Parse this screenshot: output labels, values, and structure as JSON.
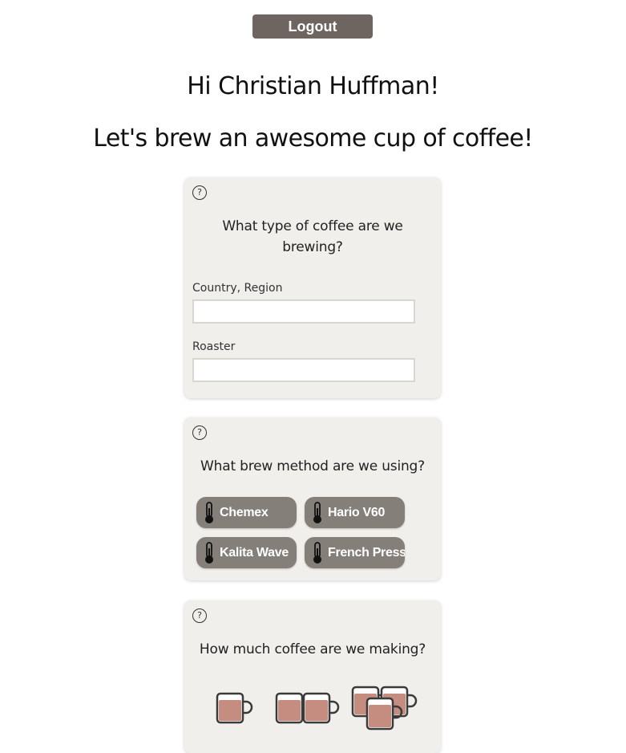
{
  "header": {
    "logout_label": "Logout"
  },
  "greeting": {
    "hello": "Hi Christian Huffman!",
    "tagline": "Let's brew an awesome cup of coffee!"
  },
  "coffee_type": {
    "help": "?",
    "question": "What type of coffee are we brewing?",
    "fields": [
      {
        "label": "Country, Region",
        "value": "",
        "placeholder": ""
      },
      {
        "label": "Roaster",
        "value": "",
        "placeholder": ""
      }
    ]
  },
  "brew_method": {
    "help": "?",
    "question": "What brew method are we using?",
    "options": [
      {
        "label": "Chemex",
        "icon": "thermometer-icon"
      },
      {
        "label": "Hario V60",
        "icon": "thermometer-icon"
      },
      {
        "label": "Kalita Wave",
        "icon": "thermometer-icon"
      },
      {
        "label": "French Press",
        "icon": "thermometer-icon"
      }
    ]
  },
  "amount": {
    "help": "?",
    "question": "How much coffee are we making?",
    "options": [
      {
        "icon": "one-cup-icon",
        "cups": 1
      },
      {
        "icon": "two-cups-icon",
        "cups": 2
      },
      {
        "icon": "three-cups-icon",
        "cups": 3
      }
    ]
  },
  "colors": {
    "button": "#6e6560",
    "method_button": "#857f7a",
    "card": "#f1efec",
    "coffee": "#c48d80"
  }
}
